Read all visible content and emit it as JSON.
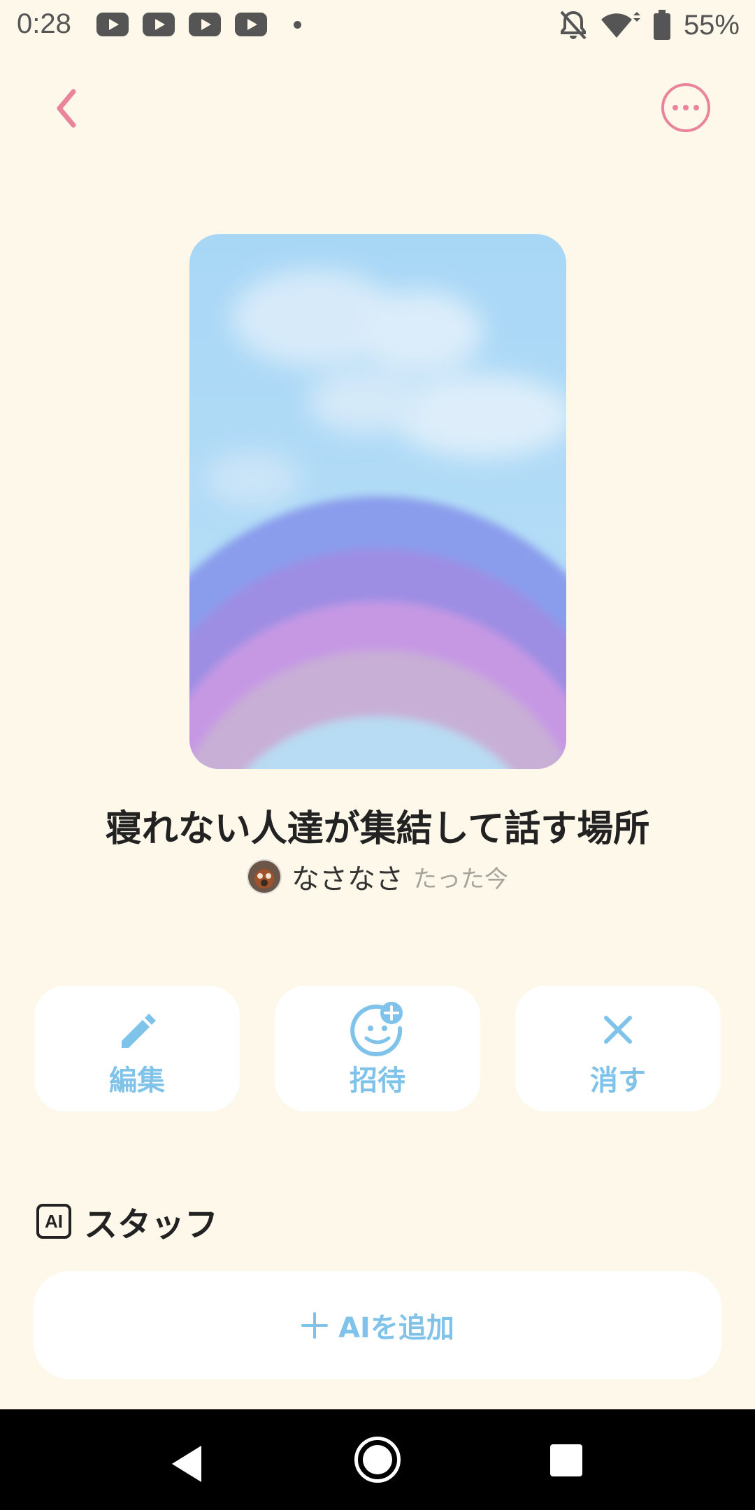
{
  "status_bar": {
    "time": "0:28",
    "battery": "55%",
    "notification_icons": [
      "youtube-icon",
      "youtube-icon",
      "youtube-icon",
      "youtube-icon",
      "dot-icon"
    ],
    "system_icons": [
      "bell-off-icon",
      "wifi-icon",
      "battery-icon"
    ]
  },
  "nav": {
    "back_icon": "chevron-left-icon",
    "more_icon": "more-horizontal-icon",
    "accent_color": "#e9849a"
  },
  "room": {
    "title": "寝れない人達が集結して話す場所",
    "author": "なさなさ",
    "time": "たった今"
  },
  "actions": {
    "edit_label": "編集",
    "invite_label": "招待",
    "delete_label": "消す",
    "color": "#7fc3ea"
  },
  "staff": {
    "badge": "AI",
    "title": "スタッフ",
    "add_label": "AIを追加"
  },
  "colors": {
    "background": "#fdf8ea",
    "card": "#ffffff",
    "text": "#222222"
  }
}
